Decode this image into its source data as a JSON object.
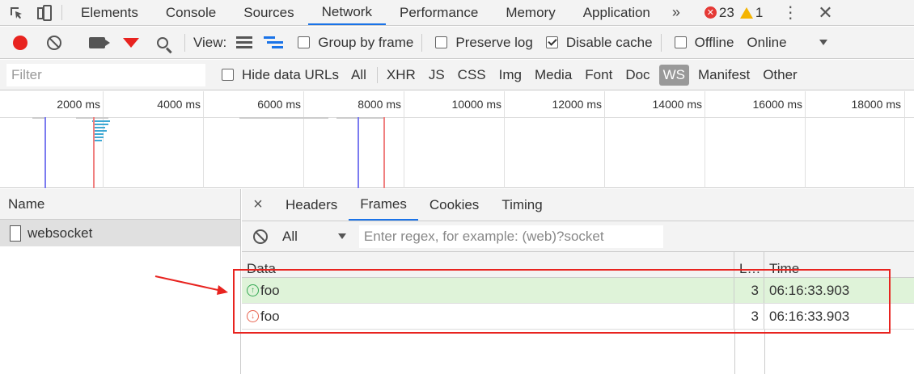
{
  "top_tabs": [
    "Elements",
    "Console",
    "Sources",
    "Network",
    "Performance",
    "Memory",
    "Application"
  ],
  "top_active": "Network",
  "more_symbol": "»",
  "error_count": "23",
  "warning_count": "1",
  "toolbar": {
    "view_label": "View:",
    "group_by_frame": "Group by frame",
    "preserve_log": "Preserve log",
    "disable_cache": "Disable cache",
    "offline": "Offline",
    "throttle": "Online"
  },
  "filter": {
    "placeholder": "Filter",
    "hide_data_urls": "Hide data URLs",
    "types": [
      "All",
      "XHR",
      "JS",
      "CSS",
      "Img",
      "Media",
      "Font",
      "Doc",
      "WS",
      "Manifest",
      "Other"
    ],
    "active_type": "WS"
  },
  "timeline_ticks": [
    "2000 ms",
    "4000 ms",
    "6000 ms",
    "8000 ms",
    "10000 ms",
    "12000 ms",
    "14000 ms",
    "16000 ms",
    "18000 ms"
  ],
  "name_panel": {
    "header": "Name",
    "rows": [
      "websocket"
    ]
  },
  "details": {
    "close": "×",
    "tabs": [
      "Headers",
      "Frames",
      "Cookies",
      "Timing"
    ],
    "active_tab": "Frames",
    "frame_filter": "All",
    "regex_placeholder": "Enter regex, for example: (web)?socket",
    "columns": {
      "data": "Data",
      "length": "L…",
      "time": "Time"
    },
    "frames": [
      {
        "direction": "sent",
        "data": "foo",
        "length": "3",
        "time": "06:16:33.903"
      },
      {
        "direction": "received",
        "data": "foo",
        "length": "3",
        "time": "06:16:33.903"
      }
    ]
  },
  "colors": {
    "accent": "#1a73e8",
    "record": "#e8231f",
    "sent_row": "#dff3d9",
    "annotation": "#e8231f"
  }
}
